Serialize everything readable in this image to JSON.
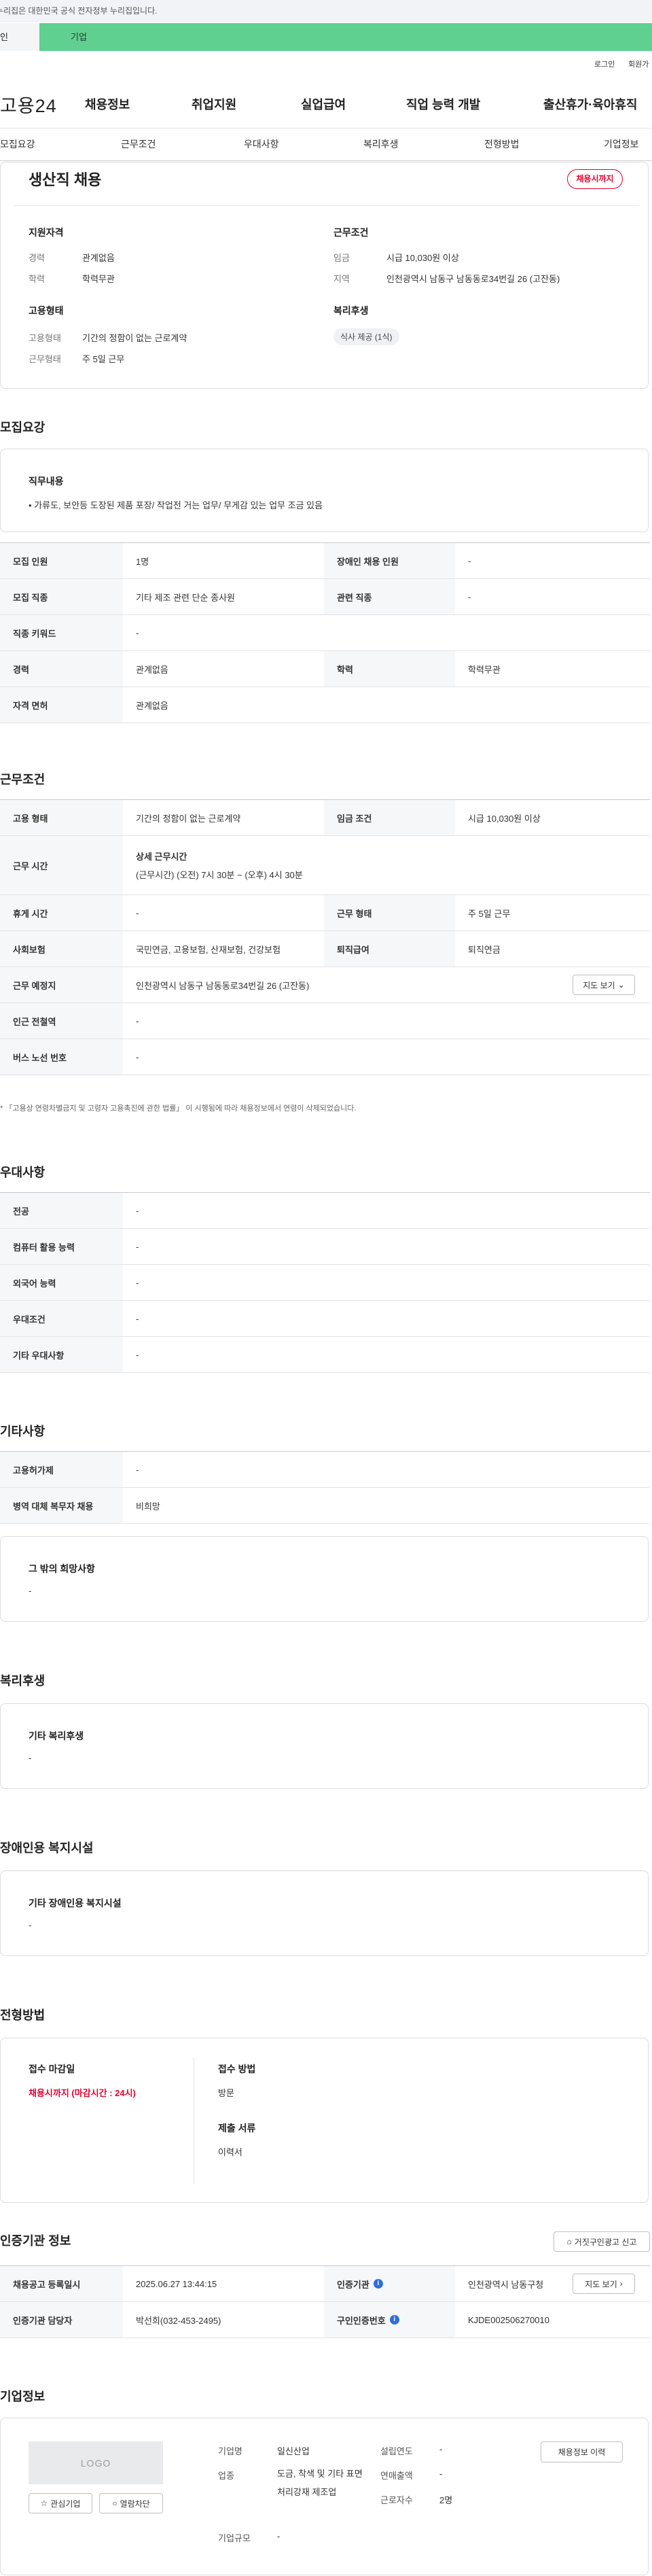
{
  "gov_banner": {
    "text": "누리집은 대한민국 공식 전자정부 누리집입니다."
  },
  "top_tabs": [
    {
      "label": "인"
    },
    {
      "label": "기업"
    }
  ],
  "util_links": [
    {
      "label": "로그인"
    },
    {
      "label": "회원가"
    }
  ],
  "logo": "고용24",
  "main_nav": [
    "채용정보",
    "취업지원",
    "실업급여",
    "직업 능력 개발",
    "출산휴가·육아휴직"
  ],
  "sub_tabs": [
    "모집요강",
    "근무조건",
    "우대사항",
    "복리후생",
    "전형방법",
    "기업정보"
  ],
  "summary": {
    "title": "생산직 채용",
    "badge": "채용시까지",
    "qualification": {
      "heading": "지원자격",
      "rows": [
        {
          "label": "경력",
          "value": "관계없음"
        },
        {
          "label": "학력",
          "value": "학력무관"
        }
      ]
    },
    "employment": {
      "heading": "고용형태",
      "rows": [
        {
          "label": "고용형태",
          "value": "기간의 정함이 없는 근로계약"
        },
        {
          "label": "근무형태",
          "value": "주 5일 근무"
        }
      ]
    },
    "conditions": {
      "heading": "근무조건",
      "rows": [
        {
          "label": "임금",
          "value": "시급 10,030원 이상"
        },
        {
          "label": "지역",
          "value": "인천광역시 남동구 남동동로34번길 26 (고잔동)"
        }
      ]
    },
    "welfare": {
      "heading": "복리후생",
      "chips": [
        "식사 제공 (1식)"
      ]
    }
  },
  "recruitment": {
    "heading": "모집요강",
    "job_desc": {
      "title": "직무내용",
      "text": "• 가류도, 보안등 도장된 제품 포장/ 작업전 거는 업무/ 무게감 있는 업무 조금 있음"
    },
    "rows": [
      {
        "l1": "모집 인원",
        "v1": "1명",
        "l2": "장애인 채용 인원",
        "v2": "-"
      },
      {
        "l1": "모집 직종",
        "v1": "기타 제조 관련 단순 종사원",
        "l2": "관련 직종",
        "v2": "-"
      },
      {
        "l1": "직종 키워드",
        "v1": "-"
      },
      {
        "l1": "경력",
        "v1": "관계없음",
        "l2": "학력",
        "v2": "학력무관"
      },
      {
        "l1": "자격 면허",
        "v1": "관계없음"
      }
    ]
  },
  "work_conditions": {
    "heading": "근무조건",
    "rows": [
      {
        "l1": "고용 형태",
        "v1": "기간의 정함이 없는 근로계약",
        "l2": "임금 조건",
        "v2": "시급 10,030원 이상"
      },
      {
        "l1": "근무 시간",
        "v1_title": "상세 근무시간",
        "v1": "(근무시간) (오전) 7시 30분 ~ (오후) 4시 30분"
      },
      {
        "l1": "휴게 시간",
        "v1": "-",
        "l2": "근무 형태",
        "v2": "주 5일 근무"
      },
      {
        "l1": "사회보험",
        "v1": "국민연금, 고용보험, 산재보험, 건강보험",
        "l2": "퇴직급여",
        "v2": "퇴직연금"
      },
      {
        "l1": "근무 예정지",
        "v1": "인천광역시 남동구 남동동로34번길 26 (고잔동)",
        "button": "지도 보기"
      },
      {
        "l1": "인근 전철역",
        "v1": "-"
      },
      {
        "l1": "버스 노선 번호",
        "v1": "-"
      }
    ],
    "note": "* 「고용상 연령차별금지 및 고령자 고용촉진에 관한 법률」 이 시행됨에 따라 채용정보에서 연령이 삭제되었습니다."
  },
  "preferences": {
    "heading": "우대사항",
    "rows": [
      {
        "label": "전공",
        "value": "-"
      },
      {
        "label": "컴퓨터 활용 능력",
        "value": "-"
      },
      {
        "label": "외국어 능력",
        "value": "-"
      },
      {
        "label": "우대조건",
        "value": "-"
      },
      {
        "label": "기타 우대사항",
        "value": "-"
      }
    ]
  },
  "other": {
    "heading": "기타사항",
    "rows": [
      {
        "label": "고용허가제",
        "value": "-"
      },
      {
        "label": "병역 대체 복무자 채용",
        "value": "비희망"
      }
    ],
    "wish": {
      "title": "그 밖의 희망사항",
      "value": "-"
    }
  },
  "benefits": {
    "heading": "복리후생",
    "title": "기타 복리후생",
    "value": "-"
  },
  "disability": {
    "heading": "장애인용 복지시설",
    "title": "기타 장애인용 복지시설",
    "value": "-"
  },
  "selection": {
    "heading": "전형방법",
    "deadline_title": "접수 마감일",
    "deadline_value": "채용시까지 (마감시간 : 24시)",
    "method_title": "접수 방법",
    "method_value": "방문",
    "docs_title": "제출 서류",
    "docs_value": "이력서"
  },
  "certification": {
    "heading": "인증기관 정보",
    "report_button": "거짓구인광고 신고",
    "rows": [
      {
        "l1": "채용공고 등록일시",
        "v1": "2025.06.27 13:44:15",
        "l2": "인증기관",
        "v2": "인천광역시 남동구청",
        "button": "지도 보기"
      },
      {
        "l1": "인증기관 담당자",
        "v1": "박선희(032-453-2495)",
        "l2": "구인인증번호",
        "v2": "KJDE002506270010"
      }
    ]
  },
  "company": {
    "heading": "기업정보",
    "logo_placeholder": "LOGO",
    "favorite_button": "관심기업",
    "block_button": "열람차단",
    "history_button": "채용정보 이력",
    "fields": {
      "name_label": "기업명",
      "name_value": "일신산업",
      "industry_label": "업종",
      "industry_value": "도금, 착색 및 기타 표면처리강재 제조업",
      "size_label": "기업규모",
      "size_value": "-",
      "founded_label": "설립연도",
      "founded_value": "-",
      "revenue_label": "연매출액",
      "revenue_value": "-",
      "employees_label": "근로자수",
      "employees_value": "2명"
    }
  },
  "colors": {
    "brand_green": "#5fd08f",
    "accent_red": "#e6002d",
    "info_blue": "#2e6fdb"
  }
}
